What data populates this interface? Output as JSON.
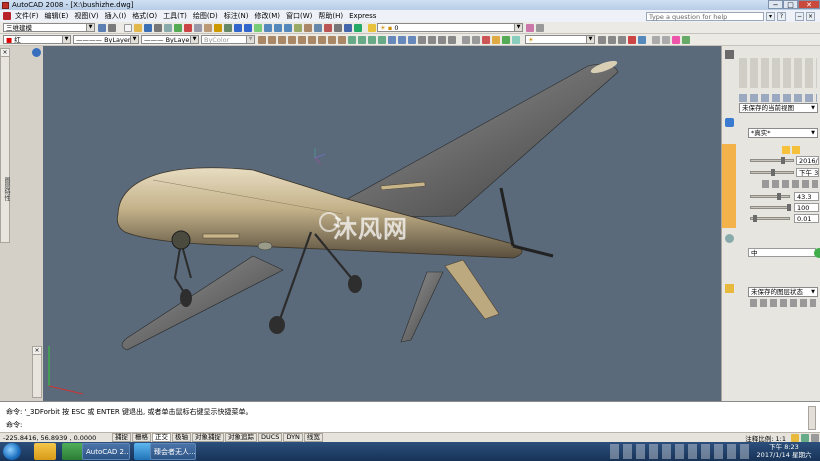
{
  "window": {
    "title": "AutoCAD 2008 - [X:\\bushizhe.dwg]"
  },
  "menu": [
    "文件(F)",
    "编辑(E)",
    "视图(V)",
    "插入(I)",
    "格式(O)",
    "工具(T)",
    "绘图(D)",
    "标注(N)",
    "修改(M)",
    "窗口(W)",
    "帮助(H)",
    "Express"
  ],
  "help_search": {
    "placeholder": "Type a question for help"
  },
  "toolbar": {
    "workspace": "三维建模",
    "layer": "红",
    "linetype1": "ByLayer",
    "linetype2": "ByLayer",
    "color": "ByColor",
    "layer_state": "0"
  },
  "left_palette": {
    "label": "图层特性"
  },
  "right_panel": {
    "view_combo": "未保存的当前视图",
    "visual_style": "*真实*",
    "date": "2016/9",
    "time": "下午 3:2",
    "val1": "43.3",
    "val2": "100",
    "val3": "0.01",
    "material_field": "中",
    "layer_state_combo": "未保存的图层状态"
  },
  "command": {
    "line1": "命令: '_3DForbit 按 ESC 或 ENTER 键退出, 或者单击鼠标右键显示快捷菜单。",
    "line2": "命令:"
  },
  "status": {
    "coords": "-225.8416, 56.8939 , 0.0000",
    "buttons": [
      "捕捉",
      "栅格",
      "正交",
      "极轴",
      "对象捕捉",
      "对象追踪",
      "DUCS",
      "DYN",
      "线宽"
    ],
    "active": "正交",
    "scale": "注释比例: 1:1"
  },
  "taskbar": {
    "task1": "AutoCAD 2...",
    "task2": "臻会者无人...",
    "time": "下午 8:23",
    "date": "2017/1/14 星期六"
  },
  "watermark": "沐风网",
  "colors": {
    "viewport_bg": "#5a6a7b",
    "taskbar": "#1e3a60",
    "airframe": "#c9b996"
  }
}
